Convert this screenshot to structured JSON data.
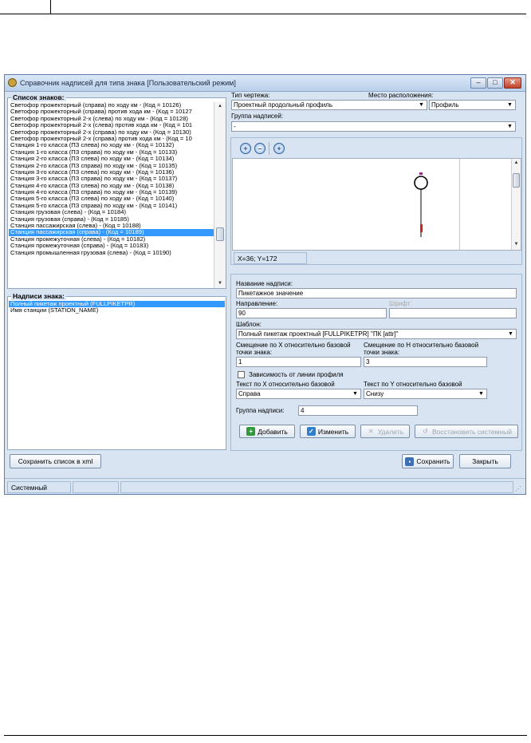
{
  "window": {
    "title": "Справочник надписей для типа знака [Пользовательский режим]",
    "controls": {
      "minimize": "–",
      "maximize": "□",
      "close": "✕"
    }
  },
  "sign_list": {
    "label": "Список знаков:",
    "items": [
      "Светофор прожекторный (справа) по ходу км - (Код = 10126)",
      "Светофор прожекторный (справа) против хода км - (Код = 10127",
      "Светофор прожекторный 2-х (слева) по ходу км - (Код = 10128)",
      "Светофор прожекторный 2-х (слева) против хода км - (Код = 101",
      "Светофор прожекторный 2-х (справа) по ходу км - (Код = 10130)",
      "Светофор прожекторный 2-х (справа) против хода км - (Код = 10",
      "Станция 1-го класса (ПЗ слева) по ходу км - (Код = 10132)",
      "Станция 1-го класса (ПЗ справа) по ходу км - (Код = 10133)",
      "Станция 2-го класса (ПЗ слева) по ходу км - (Код = 10134)",
      "Станция 2-го класса (ПЗ справа) по ходу км - (Код = 10135)",
      "Станция 3-го класса (ПЗ слева) по ходу км - (Код = 10136)",
      "Станция 3-го класса (ПЗ справа) по ходу км - (Код = 10137)",
      "Станция 4-го класса (ПЗ слева) по ходу км - (Код = 10138)",
      "Станция 4-го класса (ПЗ справа) по ходу км - (Код = 10139)",
      "Станция 5-го класса (ПЗ слева) по ходу км - (Код = 10140)",
      "Станция 5-го класса (ПЗ справа) по ходу км - (Код = 10141)",
      "Станция грузовая (слева) - (Код = 10184)",
      "Станция грузовая (справа) - (Код = 10185)",
      "Станция пассажирская (слева) - (Код = 10188)",
      "Станция пассажирская (справа) - (Код = 10189)",
      "Станция промежуточная (слева) - (Код = 10182)",
      "Станция промежуточная (справа) - (Код = 10183)",
      "Станция промышленная грузовая (слева) - (Код = 10190)"
    ],
    "selected_index": 19
  },
  "sign_labels": {
    "label": "Надписи знака:",
    "items": [
      "Полный пикетаж проектный (FULLPIKETPR)",
      "Имя станции (STATION_NAME)"
    ],
    "selected_index": 0
  },
  "drawing_type": {
    "label": "Тип чертежа:",
    "value": "Проектный продольный профиль"
  },
  "location": {
    "label": "Место расположения:",
    "value": "Профиль"
  },
  "label_group_top": {
    "label": "Группа надписей:",
    "value": "-"
  },
  "preview": {
    "coords": "X=36; Y=172",
    "zoom_in": "+",
    "zoom_out": "–",
    "zoom_fit": "+"
  },
  "form": {
    "name_label": "Название надписи:",
    "name_value": "Пикетажное значение",
    "direction_label": "Направление:",
    "direction_value": "90",
    "font_label": "Шрифт:",
    "font_value": "",
    "template_label": "Шаблон:",
    "template_value": "Полный пикетаж проектный [FULLPIKETPR] \"ПК [attr]\"",
    "offset_x_label_1": "Смещение по X относительно базовой",
    "offset_x_label_2": "точки знака:",
    "offset_x_value": "1",
    "offset_h_label_1": "Смещение по H относительно базовой",
    "offset_h_label_2": "точки знака:",
    "offset_h_value": "3",
    "profile_dependency_label": "Зависимость от линии профиля",
    "profile_dependency_checked": false,
    "text_x_label": "Текст по X относительно базовой",
    "text_x_value": "Справа",
    "text_y_label": "Текст по Y относительно базовой",
    "text_y_value": "Снизу",
    "group_label": "Группа надписи:",
    "group_value": "4"
  },
  "actions": {
    "add": "Добавить",
    "edit": "Изменить",
    "delete": "Удалить",
    "restore": "Восстановить системный"
  },
  "bottom": {
    "save_xml": "Сохранить список в xml",
    "save": "Сохранить",
    "close": "Закрыть"
  },
  "statusbar": {
    "mode": "Системный"
  }
}
